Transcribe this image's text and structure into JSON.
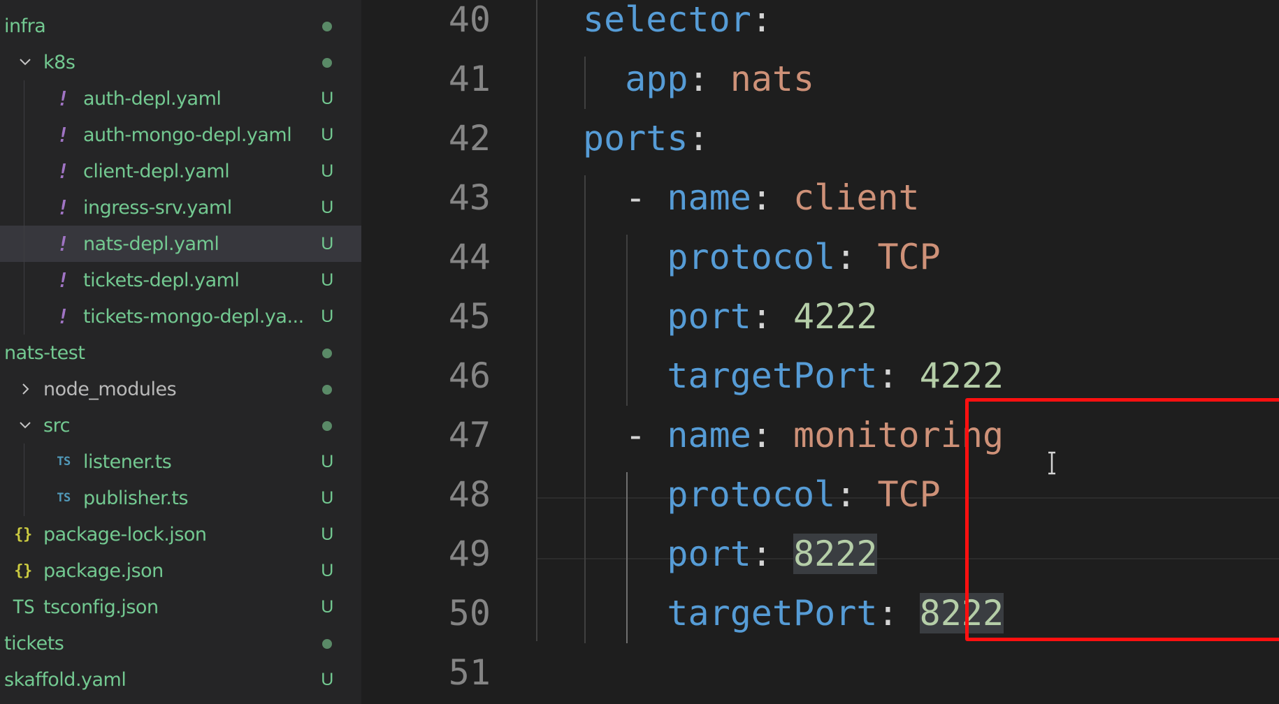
{
  "explorer": {
    "items": [
      {
        "label": "infra",
        "status": "",
        "kind": "folder-open-root",
        "icon": "none"
      },
      {
        "label": "k8s",
        "status": "",
        "kind": "folder-open",
        "icon": "chevron-down-icon"
      },
      {
        "label": "auth-depl.yaml",
        "status": "U",
        "kind": "yaml",
        "icon": "yaml-icon"
      },
      {
        "label": "auth-mongo-depl.yaml",
        "status": "U",
        "kind": "yaml",
        "icon": "yaml-icon"
      },
      {
        "label": "client-depl.yaml",
        "status": "U",
        "kind": "yaml",
        "icon": "yaml-icon"
      },
      {
        "label": "ingress-srv.yaml",
        "status": "U",
        "kind": "yaml",
        "icon": "yaml-icon"
      },
      {
        "label": "nats-depl.yaml",
        "status": "U",
        "kind": "yaml",
        "icon": "yaml-icon",
        "selected": true
      },
      {
        "label": "tickets-depl.yaml",
        "status": "U",
        "kind": "yaml",
        "icon": "yaml-icon"
      },
      {
        "label": "tickets-mongo-depl.ya...",
        "status": "U",
        "kind": "yaml",
        "icon": "yaml-icon"
      },
      {
        "label": "nats-test",
        "status": "",
        "kind": "folder-root",
        "icon": "none"
      },
      {
        "label": "node_modules",
        "status": "",
        "kind": "folder-closed",
        "icon": "chevron-right-icon"
      },
      {
        "label": "src",
        "status": "",
        "kind": "folder-open",
        "icon": "chevron-down-icon"
      },
      {
        "label": "listener.ts",
        "status": "U",
        "kind": "ts",
        "icon": "typescript-icon"
      },
      {
        "label": "publisher.ts",
        "status": "U",
        "kind": "ts",
        "icon": "typescript-icon"
      },
      {
        "label": "package-lock.json",
        "status": "U",
        "kind": "json",
        "icon": "json-icon"
      },
      {
        "label": "package.json",
        "status": "U",
        "kind": "json",
        "icon": "json-icon"
      },
      {
        "label": "tsconfig.json",
        "status": "U",
        "kind": "tsconfig",
        "icon": "tsconfig-icon"
      },
      {
        "label": "tickets",
        "status": "",
        "kind": "folder-root",
        "icon": "none"
      },
      {
        "label": "skaffold.yaml",
        "status": "U",
        "kind": "file-root",
        "icon": "none"
      }
    ],
    "icon_glyphs": {
      "yaml": "!",
      "ts": "TS",
      "json": "{}",
      "tsconfig": "TS"
    },
    "colors": {
      "untracked": "#73c991",
      "selected_bg": "#37373d",
      "sidebar_bg": "#252526"
    }
  },
  "editor": {
    "lines": [
      {
        "num": "40",
        "indent": 0,
        "tokens": [
          {
            "t": "selector",
            "c": "k"
          },
          {
            "t": ":",
            "c": "p"
          }
        ]
      },
      {
        "num": "41",
        "indent": 1,
        "tokens": [
          {
            "t": "app",
            "c": "k"
          },
          {
            "t": ": ",
            "c": "p"
          },
          {
            "t": "nats",
            "c": "s"
          }
        ]
      },
      {
        "num": "42",
        "indent": 0,
        "tokens": [
          {
            "t": "ports",
            "c": "k"
          },
          {
            "t": ":",
            "c": "p"
          }
        ]
      },
      {
        "num": "43",
        "indent": 1,
        "tokens": [
          {
            "t": "- ",
            "c": "p"
          },
          {
            "t": "name",
            "c": "k"
          },
          {
            "t": ": ",
            "c": "p"
          },
          {
            "t": "client",
            "c": "s"
          }
        ]
      },
      {
        "num": "44",
        "indent": 2,
        "tokens": [
          {
            "t": "protocol",
            "c": "k"
          },
          {
            "t": ": ",
            "c": "p"
          },
          {
            "t": "TCP",
            "c": "s"
          }
        ]
      },
      {
        "num": "45",
        "indent": 2,
        "tokens": [
          {
            "t": "port",
            "c": "k"
          },
          {
            "t": ": ",
            "c": "p"
          },
          {
            "t": "4222",
            "c": "n"
          }
        ]
      },
      {
        "num": "46",
        "indent": 2,
        "tokens": [
          {
            "t": "targetPort",
            "c": "k"
          },
          {
            "t": ": ",
            "c": "p"
          },
          {
            "t": "4222",
            "c": "n"
          }
        ]
      },
      {
        "num": "47",
        "indent": 1,
        "tokens": [
          {
            "t": "- ",
            "c": "p"
          },
          {
            "t": "name",
            "c": "k"
          },
          {
            "t": ": ",
            "c": "p"
          },
          {
            "t": "monitoring",
            "c": "s"
          }
        ]
      },
      {
        "num": "48",
        "indent": 2,
        "tokens": [
          {
            "t": "protocol",
            "c": "k"
          },
          {
            "t": ": ",
            "c": "p"
          },
          {
            "t": "TCP",
            "c": "s"
          }
        ]
      },
      {
        "num": "49",
        "indent": 2,
        "tokens": [
          {
            "t": "port",
            "c": "k"
          },
          {
            "t": ": ",
            "c": "p"
          },
          {
            "t": "8222",
            "c": "n",
            "hl": true
          }
        ]
      },
      {
        "num": "50",
        "indent": 2,
        "tokens": [
          {
            "t": "targetPort",
            "c": "k"
          },
          {
            "t": ": ",
            "c": "p"
          },
          {
            "t": "8222",
            "c": "n",
            "hl": true
          }
        ]
      },
      {
        "num": "51",
        "indent": 0,
        "tokens": []
      }
    ],
    "colors": {
      "key": "#569cd6",
      "string": "#ce9178",
      "number": "#b5cea8",
      "punct": "#d4d4d4",
      "annotation_box": "#ff1010"
    }
  }
}
